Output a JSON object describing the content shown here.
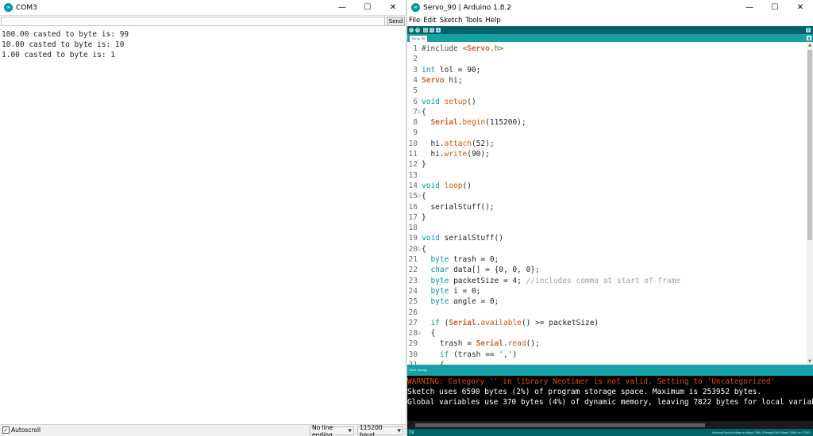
{
  "colors": {
    "teal_dark": "#006468",
    "teal_light": "#17a1a5",
    "keyword": "#00979c",
    "function": "#d35400",
    "warning": "#e34c00",
    "console_bg": "#000000"
  },
  "serial_monitor": {
    "title": "COM3",
    "app_icon": "arduino-logo-icon",
    "input_value": "",
    "send_label": "Send",
    "output_lines": [
      "100.00 casted to byte is: 99",
      "10.00 casted to byte is: 10",
      "1.00 casted to byte is: 1"
    ],
    "autoscroll_label": "Autoscroll",
    "autoscroll_checked": true,
    "line_ending": "No line ending",
    "baud_rate": "115200 baud"
  },
  "ide": {
    "title": "Servo_90 | Arduino 1.8.2",
    "app_icon": "arduino-logo-icon",
    "menu": [
      "File",
      "Edit",
      "Sketch",
      "Tools",
      "Help"
    ],
    "toolbar_buttons": [
      "verify-icon",
      "upload-icon",
      "new-icon",
      "open-icon",
      "save-icon"
    ],
    "tab_name": "Servo_90",
    "code_lines": [
      {
        "n": "1",
        "fold": "",
        "text": "#include <Servo.h>"
      },
      {
        "n": "2",
        "fold": "",
        "text": ""
      },
      {
        "n": "3",
        "fold": "",
        "text": "int lol = 90;"
      },
      {
        "n": "4",
        "fold": "",
        "text": "Servo hi;"
      },
      {
        "n": "5",
        "fold": "",
        "text": ""
      },
      {
        "n": "6",
        "fold": "",
        "text": "void setup()"
      },
      {
        "n": "7",
        "fold": "⊟",
        "text": "{"
      },
      {
        "n": "8",
        "fold": "",
        "text": "  Serial.begin(115200);"
      },
      {
        "n": "9",
        "fold": "",
        "text": ""
      },
      {
        "n": "10",
        "fold": "",
        "text": "  hi.attach(52);"
      },
      {
        "n": "11",
        "fold": "",
        "text": "  hi.write(90);"
      },
      {
        "n": "12",
        "fold": "",
        "text": "}"
      },
      {
        "n": "13",
        "fold": "",
        "text": ""
      },
      {
        "n": "14",
        "fold": "",
        "text": "void loop()"
      },
      {
        "n": "15",
        "fold": "⊟",
        "text": "{"
      },
      {
        "n": "16",
        "fold": "",
        "text": "  serialStuff();"
      },
      {
        "n": "17",
        "fold": "",
        "text": "}"
      },
      {
        "n": "18",
        "fold": "",
        "text": ""
      },
      {
        "n": "19",
        "fold": "",
        "text": "void serialStuff()"
      },
      {
        "n": "20",
        "fold": "⊟",
        "text": "{"
      },
      {
        "n": "21",
        "fold": "",
        "text": "  byte trash = 0;"
      },
      {
        "n": "22",
        "fold": "",
        "text": "  char data[] = {0, 0, 0};"
      },
      {
        "n": "23",
        "fold": "",
        "text": "  byte packetSize = 4; //includes comma at start of frame"
      },
      {
        "n": "24",
        "fold": "",
        "text": "  byte i = 0;"
      },
      {
        "n": "25",
        "fold": "",
        "text": "  byte angle = 0;"
      },
      {
        "n": "26",
        "fold": "",
        "text": ""
      },
      {
        "n": "27",
        "fold": "",
        "text": "  if (Serial.available() >= packetSize)"
      },
      {
        "n": "28",
        "fold": "⊟",
        "text": "  {"
      },
      {
        "n": "29",
        "fold": "",
        "text": "    trash = Serial.read();"
      },
      {
        "n": "30",
        "fold": "",
        "text": "    if (trash == ',')"
      },
      {
        "n": "31",
        "fold": "",
        "text": "    {"
      }
    ],
    "status_text": "Done Saving.",
    "console_lines": [
      {
        "kind": "warn",
        "text": "WARNING: Category '' in library Neotimer is not valid. Setting to 'Uncategorized'"
      },
      {
        "kind": "info",
        "text": "Sketch uses 6590 bytes (2%) of program storage space. Maximum is 253952 bytes."
      },
      {
        "kind": "info",
        "text": "Global variables use 370 bytes (4%) of dynamic memory, leaving 7822 bytes for local variables."
      }
    ],
    "cursor_line": "19",
    "board_info": "Arduino/Genuino Mega or Mega 2560, ATmega2560 (Mega 2560) on COM3"
  }
}
